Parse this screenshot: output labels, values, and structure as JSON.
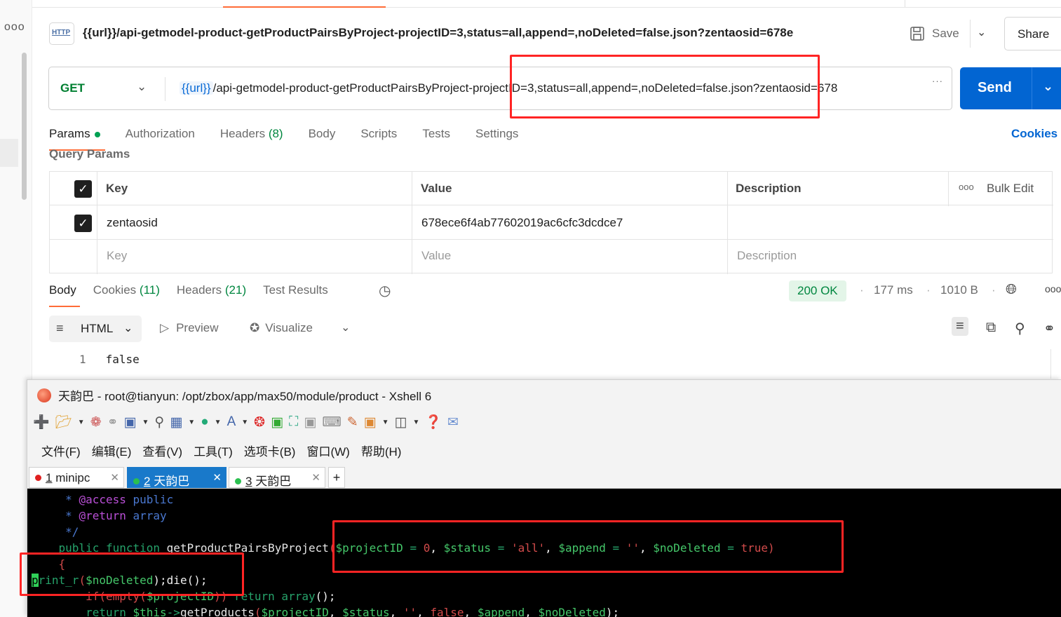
{
  "request": {
    "title": "{{url}}/api-getmodel-product-getProductPairsByProject-projectID=3,status=all,append=,noDeleted=false.json?zentaosid=678e",
    "save_label": "Save",
    "share_label": "Share",
    "http_badge": "HTTP",
    "method": "GET",
    "url_var": "{{url}}",
    "url_rest": "/api-getmodel-product-getProductPairsByProject-projectID=3,status=all,append=,noDeleted=false.json?zentaosid=678",
    "send_label": "Send"
  },
  "request_tabs": {
    "params": "Params",
    "authorization": "Authorization",
    "headers": "Headers",
    "headers_count": "(8)",
    "body": "Body",
    "scripts": "Scripts",
    "tests": "Tests",
    "settings": "Settings",
    "cookies": "Cookies"
  },
  "query_params": {
    "section_label": "Query Params",
    "headers": {
      "key": "Key",
      "value": "Value",
      "description": "Description",
      "bulk_edit": "Bulk Edit"
    },
    "row": {
      "key": "zentaosid",
      "value": "678ece6f4ab77602019ac6cfc3dcdce7",
      "checked": true
    },
    "placeholders": {
      "key": "Key",
      "value": "Value",
      "description": "Description"
    }
  },
  "response": {
    "tabs": {
      "body": "Body",
      "cookies": "Cookies",
      "cookies_count": "(11)",
      "headers": "Headers",
      "headers_count": "(21)",
      "test_results": "Test Results"
    },
    "status": "200 OK",
    "time": "177 ms",
    "size": "1010 B",
    "format": "HTML",
    "preview": "Preview",
    "visualize": "Visualize",
    "line_number": "1",
    "line_content": "false"
  },
  "xshell": {
    "title": "天韵巴 - root@tianyun: /opt/zbox/app/max50/module/product - Xshell 6",
    "menu": [
      "文件(F)",
      "编辑(E)",
      "查看(V)",
      "工具(T)",
      "选项卡(B)",
      "窗口(W)",
      "帮助(H)"
    ],
    "tabs": [
      {
        "num": "1",
        "label": "minipc"
      },
      {
        "num": "2",
        "label": "天韵巴"
      },
      {
        "num": "3",
        "label": "天韵巴"
      }
    ],
    "code": {
      "l1_star": "     * ",
      "l1_tag": "@access",
      "l1_val": " public",
      "l2_star": "     * ",
      "l2_tag": "@return",
      "l2_val": " array",
      "l3": "     */",
      "l4_kw": "    public function ",
      "l4_fn": "getProductPairsByProject",
      "l4_p1": "(",
      "l4_v1": "$projectID",
      "l4_eq1": " = ",
      "l4_n1": "0",
      "l4_c1": ", ",
      "l4_v2": "$status",
      "l4_eq2": " = ",
      "l4_s2": "'all'",
      "l4_c2": ", ",
      "l4_v3": "$append",
      "l4_eq3": " = ",
      "l4_s3": "''",
      "l4_c3": ", ",
      "l4_v4": "$noDeleted",
      "l4_eq4": " = ",
      "l4_s4": "true",
      "l4_p2": ")",
      "l5": "    {",
      "l6_cur": "p",
      "l6_a": "rint_r",
      "l6_b": "(",
      "l6_v": "$noDeleted",
      "l6_c": ");die();",
      "l7_kw": "        if(empty(",
      "l7_v": "$projectID",
      "l7_e": ")) ",
      "l7_ret": "return",
      "l7_arr": " array",
      "l7_end": "();",
      "l8_ret": "        return ",
      "l8_this": "$this",
      "l8_arrow": "->",
      "l8_fn": "getProducts",
      "l8_p": "(",
      "l8_v1": "$projectID",
      "l8_c1": ", ",
      "l8_v2": "$status",
      "l8_c2": ", ",
      "l8_s": "''",
      "l8_c3": ", ",
      "l8_f": "false",
      "l8_c4": ", ",
      "l8_v3": "$append",
      "l8_c5": ", ",
      "l8_v4": "$noDeleted",
      "l8_end": ");"
    }
  },
  "colors": {
    "accent": "#ff6c37",
    "send": "#0265d2",
    "get_method": "#007f31",
    "status_ok": "#00863f",
    "highlight": "#ff2424"
  }
}
